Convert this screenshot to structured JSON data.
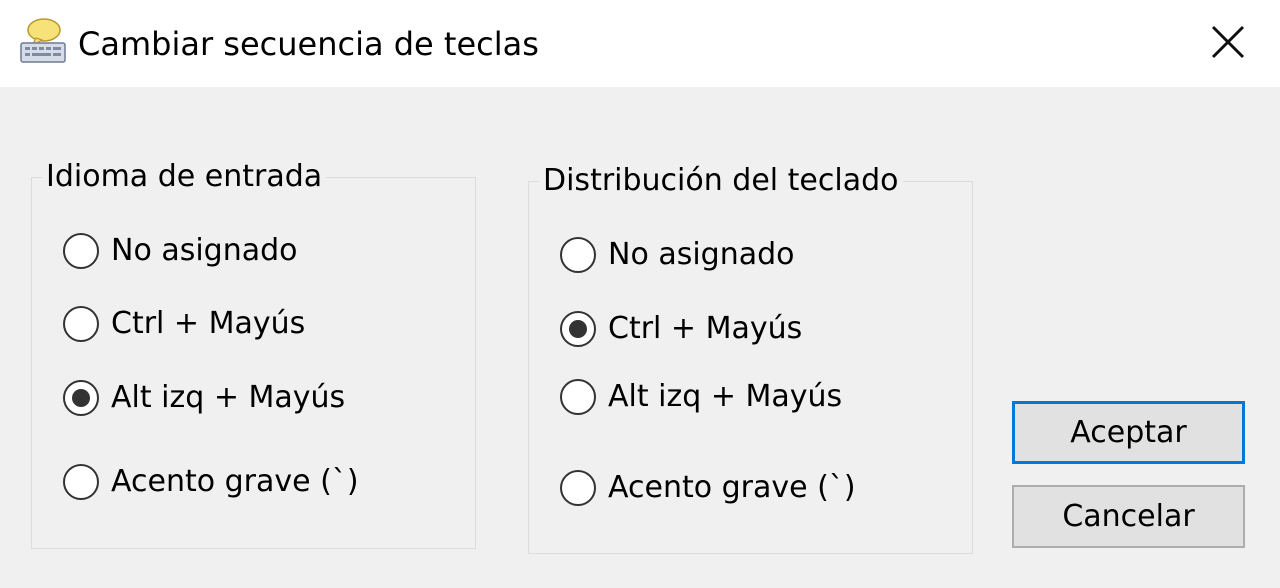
{
  "window": {
    "title": "Cambiar secuencia de teclas",
    "icon": "keyboard-speech-bubble-icon"
  },
  "groups": [
    {
      "legend": "Idioma de entrada",
      "options": [
        {
          "label": "No asignado",
          "checked": false
        },
        {
          "label": "Ctrl + Mayús",
          "checked": false
        },
        {
          "label": "Alt izq + Mayús",
          "checked": true
        },
        {
          "label": "Acento grave (`)",
          "checked": false
        }
      ]
    },
    {
      "legend": "Distribución del teclado",
      "options": [
        {
          "label": "No asignado",
          "checked": false
        },
        {
          "label": "Ctrl + Mayús",
          "checked": true
        },
        {
          "label": "Alt izq + Mayús",
          "checked": false
        },
        {
          "label": "Acento grave (`)",
          "checked": false
        }
      ]
    }
  ],
  "buttons": {
    "ok": "Aceptar",
    "cancel": "Cancelar"
  },
  "colors": {
    "default_button_border": "#0078d7",
    "dialog_background": "#f0f0f0"
  }
}
